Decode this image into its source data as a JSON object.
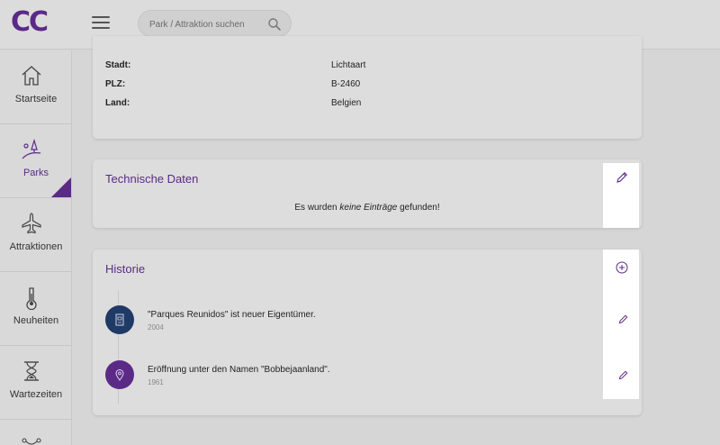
{
  "app": {
    "logo": "CC"
  },
  "search": {
    "placeholder": "Park / Attraktion suchen"
  },
  "sidebar": {
    "items": [
      {
        "label": "Startseite",
        "icon": "home-icon"
      },
      {
        "label": "Parks",
        "icon": "park-icon",
        "active": true
      },
      {
        "label": "Attraktionen",
        "icon": "plane-icon"
      },
      {
        "label": "Neuheiten",
        "icon": "thermometer-icon"
      },
      {
        "label": "Wartezeiten",
        "icon": "hourglass-icon"
      }
    ]
  },
  "address": {
    "rows": [
      {
        "key": "Stadt:",
        "value": "Lichtaart"
      },
      {
        "key": "PLZ:",
        "value": "B-2460"
      },
      {
        "key": "Land:",
        "value": "Belgien"
      }
    ]
  },
  "technical": {
    "title": "Technische Daten",
    "empty_pre": "Es wurden ",
    "empty_em": "keine Einträge",
    "empty_post": " gefunden!"
  },
  "history": {
    "title": "Historie",
    "entries": [
      {
        "text": "\"Parques Reunidos\" ist neuer Eigentümer.",
        "year": "2004",
        "color": "#1f3a66",
        "icon": "building-icon"
      },
      {
        "text": "Eröffnung unter den Namen \"Bobbejaanland\".",
        "year": "1961",
        "color": "#5b2a86",
        "icon": "location-pin-icon"
      }
    ]
  },
  "colors": {
    "accent": "#5b2a86",
    "navy": "#1f3a66"
  }
}
